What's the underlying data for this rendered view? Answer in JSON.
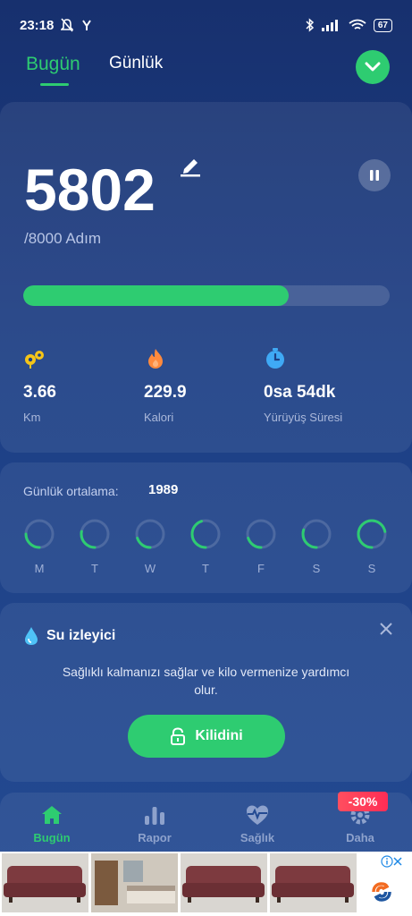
{
  "status_bar": {
    "time": "23:18",
    "battery": "67",
    "icons": [
      "mute-icon",
      "notification-icon",
      "bluetooth-icon",
      "signal-icon",
      "wifi-icon",
      "battery-icon"
    ]
  },
  "tabs": {
    "today": "Bugün",
    "daily": "Günlük"
  },
  "steps": {
    "count": "5802",
    "goal": "/8000 Adım",
    "progress_percent": 72.5
  },
  "stats": [
    {
      "value": "3.66",
      "label": "Km",
      "icon": "distance-icon",
      "color": "#f5c518"
    },
    {
      "value": "229.9",
      "label": "Kalori",
      "icon": "flame-icon",
      "color": "#ff8a3d"
    },
    {
      "value": "0sa 54dk",
      "label": "Yürüyüş Süresi",
      "icon": "stopwatch-icon",
      "color": "#3fa9f5"
    }
  ],
  "weekly": {
    "avg_label": "Günlük ortalama:",
    "avg_value": "1989",
    "days": [
      {
        "label": "M",
        "fraction": 0.25
      },
      {
        "label": "T",
        "fraction": 0.28
      },
      {
        "label": "W",
        "fraction": 0.2
      },
      {
        "label": "T",
        "fraction": 0.45
      },
      {
        "label": "F",
        "fraction": 0.2
      },
      {
        "label": "S",
        "fraction": 0.3
      },
      {
        "label": "S",
        "fraction": 0.72
      }
    ]
  },
  "water": {
    "title": "Su izleyici",
    "description": "Sağlıklı kalmanızı sağlar ve kilo vermenize yardımcı olur.",
    "unlock": "Kilidini"
  },
  "nav": {
    "items": [
      {
        "label": "Bugün",
        "icon": "home-icon"
      },
      {
        "label": "Rapor",
        "icon": "chart-icon"
      },
      {
        "label": "Sağlık",
        "icon": "heart-icon"
      },
      {
        "label": "Daha",
        "icon": "gear-icon"
      }
    ],
    "badge": "-30%"
  },
  "colors": {
    "accent": "#2ecc71",
    "background_top": "#17306e",
    "background_bottom": "#234a92"
  }
}
